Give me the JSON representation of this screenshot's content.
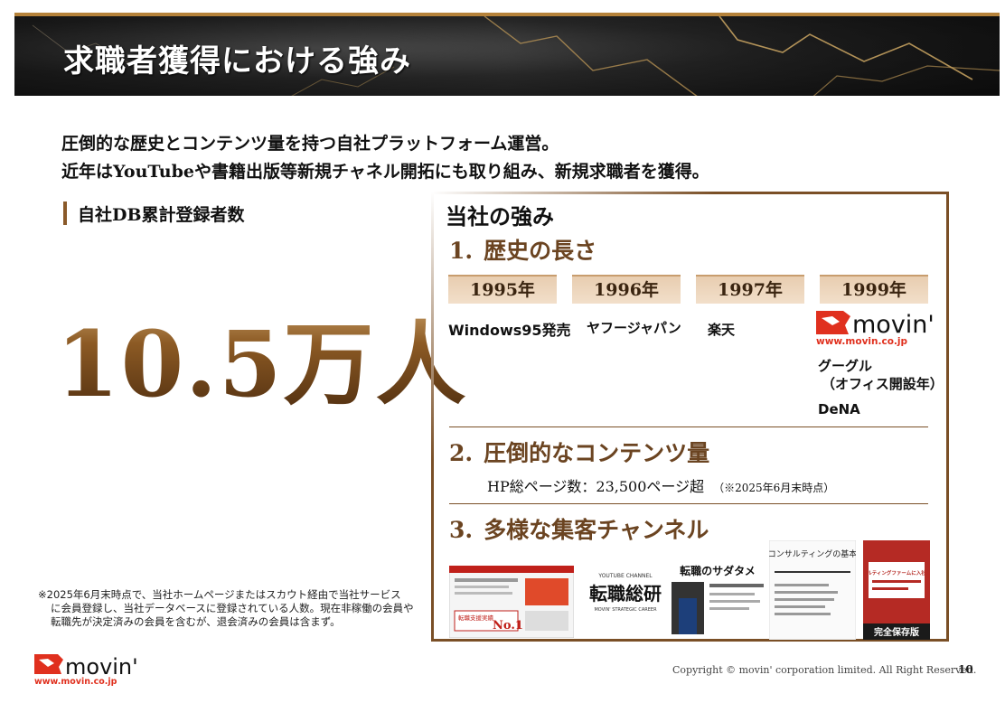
{
  "header": {
    "title": "求職者獲得における強み"
  },
  "intro": {
    "line1": "圧倒的な歴史とコンテンツ量を持つ自社プラットフォーム運営。",
    "line2": "近年はYouTubeや書籍出版等新規チャネル開拓にも取り組み、新規求職者を獲得。"
  },
  "db": {
    "label": "自社DB累計登録者数",
    "value": "10.5万人"
  },
  "footnote": {
    "line1": "※2025年6月末時点で、当社ホームページまたはスカウト経由で当社サービス",
    "line2": "に会員登録し、当社データベースに登録されている人数。現在非稼働の会員や",
    "line3": "転職先が決定済みの会員を含むが、退会済みの会員は含まず。"
  },
  "panel": {
    "title": "当社の強み",
    "sections": [
      {
        "num": "1.",
        "title": "歴史の長さ"
      },
      {
        "num": "2.",
        "title": "圧倒的なコンテンツ量"
      },
      {
        "num": "3.",
        "title": "多様な集客チャンネル"
      }
    ],
    "years": [
      "1995年",
      "1996年",
      "1997年",
      "1999年"
    ],
    "events": {
      "y1995": "Windows95発売",
      "y1996": "ヤフージャパン",
      "y1997": "楽天",
      "y1999_a": "グーグル",
      "y1999_b": "（オフィス開設年）",
      "y1999_c": "DeNA"
    },
    "movin_logo": {
      "wordmark": "movin'",
      "url": "www.movin.co.jp"
    },
    "hp": {
      "text": "HP総ページ数：23,500ページ超",
      "note": "（※2025年6月末時点）"
    },
    "channels": {
      "web_badge": "No.1",
      "web_tagline": "転職支援実績",
      "yt_channel": "YOUTUBE CHANNEL",
      "yt_title": "転職総研",
      "yt_sub": "MOVIN' STRATEGIC CAREER",
      "yt2_title": "転職のサダタメ",
      "book1_title": "コンサルティングの基本",
      "book2_title": "「コンサルティングファームに入社したい」",
      "book2_band": "完全保存版"
    }
  },
  "footer": {
    "logo_word": "movin'",
    "logo_url": "www.movin.co.jp",
    "copyright": "Copyright © movin' corporation limited. All Right Reserved.",
    "page": "10"
  },
  "colors": {
    "accent": "#7a4f26",
    "gold": "#b5823a",
    "logo_red": "#e0301e"
  }
}
